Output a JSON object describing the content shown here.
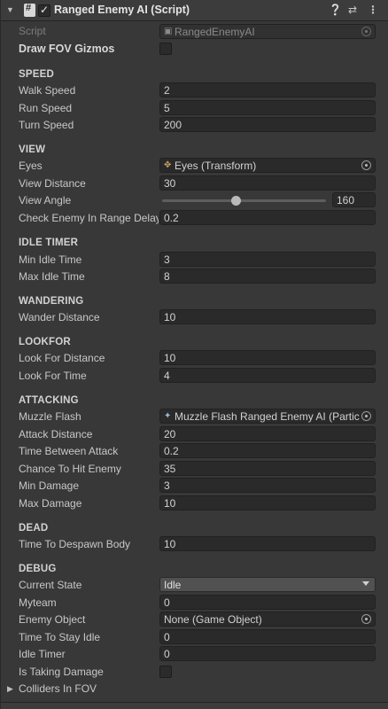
{
  "component": {
    "title": "Ranged Enemy AI (Script)",
    "enabled": true,
    "icons": [
      "help-icon",
      "presets-icon",
      "context-menu-icon"
    ]
  },
  "script": {
    "label": "Script",
    "value": "RangedEnemyAI"
  },
  "draw_fov": {
    "label": "Draw FOV Gizmos",
    "checked": false
  },
  "speed": {
    "header": "SPEED",
    "walk": {
      "label": "Walk Speed",
      "value": "2"
    },
    "run": {
      "label": "Run Speed",
      "value": "5"
    },
    "turn": {
      "label": "Turn Speed",
      "value": "200"
    }
  },
  "view": {
    "header": "VIEW",
    "eyes": {
      "label": "Eyes",
      "value": "Eyes (Transform)"
    },
    "distance": {
      "label": "View Distance",
      "value": "30"
    },
    "angle": {
      "label": "View Angle",
      "value": "160",
      "slider_fraction": 0.45
    },
    "check_delay": {
      "label": "Check Enemy In Range Delay",
      "value": "0.2"
    }
  },
  "idle_timer": {
    "header": "IDLE TIMER",
    "min": {
      "label": "Min Idle Time",
      "value": "3"
    },
    "max": {
      "label": "Max Idle Time",
      "value": "8"
    }
  },
  "wandering": {
    "header": "WANDERING",
    "distance": {
      "label": "Wander Distance",
      "value": "10"
    }
  },
  "lookfor": {
    "header": "LOOKFOR",
    "distance": {
      "label": "Look For Distance",
      "value": "10"
    },
    "time": {
      "label": "Look For Time",
      "value": "4"
    }
  },
  "attacking": {
    "header": "ATTACKING",
    "muzzle": {
      "label": "Muzzle Flash",
      "value": "Muzzle Flash Ranged Enemy AI (Partic"
    },
    "distance": {
      "label": "Attack Distance",
      "value": "20"
    },
    "time_between": {
      "label": "Time Between Attack",
      "value": "0.2"
    },
    "chance": {
      "label": "Chance To Hit Enemy",
      "value": "35"
    },
    "min_damage": {
      "label": "Min Damage",
      "value": "3"
    },
    "max_damage": {
      "label": "Max Damage",
      "value": "10"
    }
  },
  "dead": {
    "header": "DEAD",
    "despawn": {
      "label": "Time To Despawn Body",
      "value": "10"
    }
  },
  "debug": {
    "header": "DEBUG",
    "state": {
      "label": "Current State",
      "value": "Idle"
    },
    "myteam": {
      "label": "Myteam",
      "value": "0"
    },
    "enemy": {
      "label": "Enemy Object",
      "value": "None (Game Object)"
    },
    "stay_idle": {
      "label": "Time To Stay Idle",
      "value": "0"
    },
    "idle_timer": {
      "label": "Idle Timer",
      "value": "0"
    },
    "taking_damage": {
      "label": "Is Taking Damage",
      "checked": false
    },
    "colliders": {
      "label": "Colliders In FOV",
      "expanded": false
    }
  }
}
